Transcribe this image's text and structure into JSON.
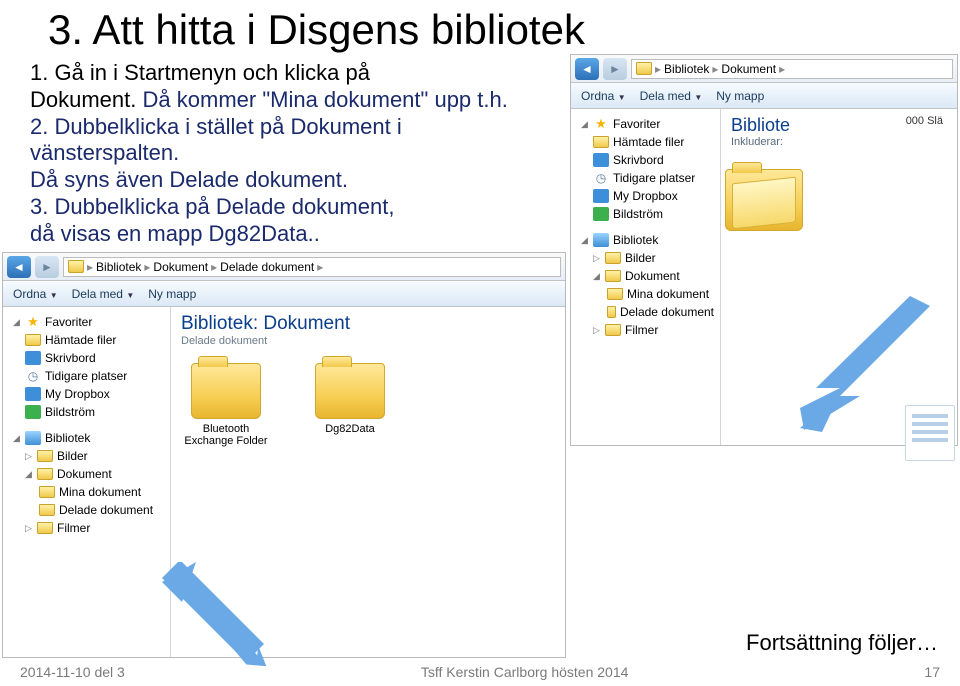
{
  "title": "3. Att hitta i Disgens bibliotek",
  "instructions": {
    "l1": "1. Gå in i Startmenyn och klicka på",
    "l2": "Dokument.",
    "l2b": "Då kommer \"Mina dokument\" upp t.h.",
    "l3": "2. Dubbelklicka i stället på Dokument i vänsterspalten.",
    "l4": "Då syns även Delade dokument.",
    "l5": "3. Dubbelklicka på Delade dokument,",
    "l6": "då visas en mapp Dg82Data.."
  },
  "explorer": {
    "toolbar": {
      "ordna": "Ordna",
      "dela": "Dela med",
      "nymapp": "Ny mapp"
    },
    "breadcrumb1": {
      "a": "Bibliotek",
      "b": "Dokument"
    },
    "breadcrumb2": {
      "a": "Bibliotek",
      "b": "Dokument",
      "c": "Delade dokument"
    },
    "sidebar": {
      "fav": "Favoriter",
      "ham": "Hämtade filer",
      "skr": "Skrivbord",
      "tid": "Tidigare platser",
      "dropbox": "My Dropbox",
      "bildstrom": "Bildström",
      "bibliotek": "Bibliotek",
      "bilder": "Bilder",
      "dokument": "Dokument",
      "mina": "Mina dokument",
      "delade": "Delade dokument",
      "filmer": "Filmer"
    },
    "main1": {
      "title": "Bibliote",
      "sub": "Inkluderar:",
      "count": "000 Slä"
    },
    "main2": {
      "title": "Bibliotek: Dokument",
      "sub": "Delade dokument",
      "f1": "Bluetooth Exchange Folder",
      "f2": "Dg82Data"
    }
  },
  "footer": {
    "date": "2014-11-10 del 3",
    "author": "Tsff Kerstin Carlborg hösten 2014",
    "page": "17",
    "cont": "Fortsättning följer…"
  }
}
